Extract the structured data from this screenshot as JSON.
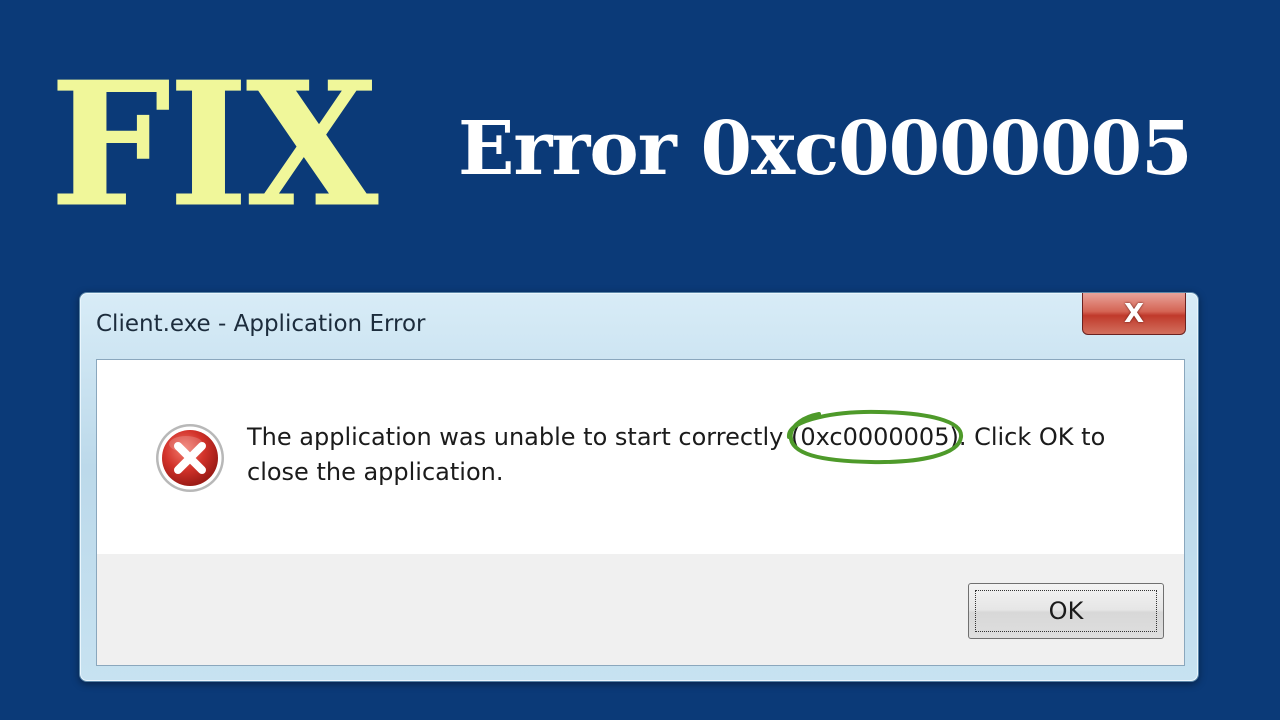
{
  "headline": {
    "fix": "FIX",
    "title": "Error 0xc0000005"
  },
  "dialog": {
    "title": "Client.exe - Application Error",
    "close_icon": "close-icon",
    "close_glyph": "X",
    "icon": "error-icon",
    "message": {
      "before_code": "The application was unable to start correctly ",
      "error_code": "(0xc0000005)",
      "after_code": ". Click OK to",
      "line2": "close the application."
    },
    "ok_label": "OK"
  },
  "colors": {
    "background": "#0b3a78",
    "fix_yellow": "#f0f79a",
    "heading_white": "#ffffff",
    "highlight_circle": "#4e9a2a",
    "error_red": "#c62828"
  }
}
